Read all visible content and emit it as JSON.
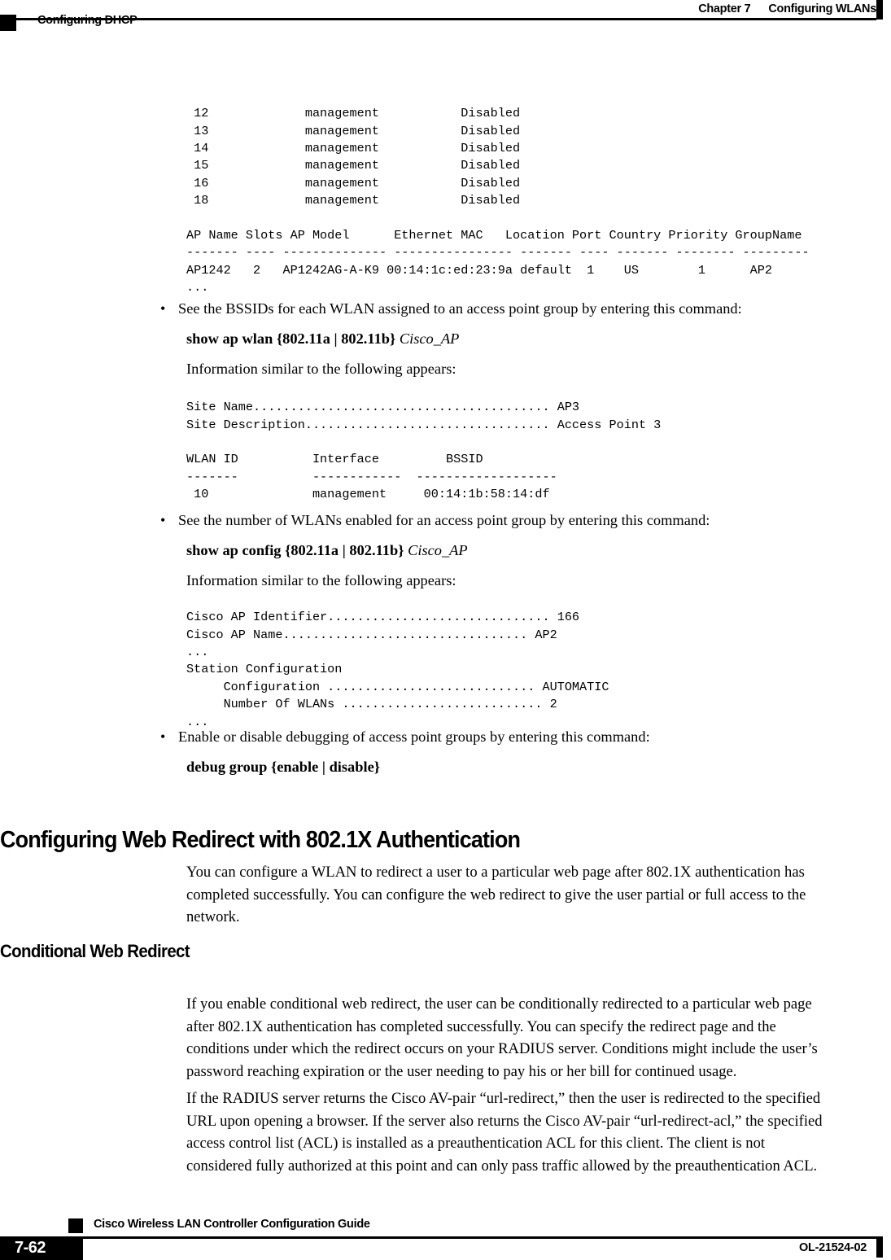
{
  "header": {
    "chapter": "Chapter 7",
    "chapter_title": "Configuring WLANs",
    "section": "Configuring DHCP"
  },
  "code_block_1": " 12             management           Disabled\n 13             management           Disabled\n 14             management           Disabled\n 15             management           Disabled\n 16             management           Disabled\n 18             management           Disabled\n\nAP Name Slots AP Model      Ethernet MAC   Location Port Country Priority GroupName\n------- ---- -------------- ---------------- ------- ---- ------- -------- ---------\nAP1242   2   AP1242AG-A-K9 00:14:1c:ed:23:9a default  1    US        1      AP2\n...",
  "bullet_1": {
    "text": "See the BSSIDs for each WLAN assigned to an access point group by entering this command:",
    "command_bold_1": "show ap wlan",
    "command_brace_open": "{",
    "command_opt_1": "802.11a",
    "command_pipe": "|",
    "command_opt_2": "802.11b",
    "command_brace_close": "}",
    "command_italic": "Cisco_AP",
    "lead": "Information similar to the following appears:"
  },
  "code_block_2": "Site Name........................................ AP3\nSite Description................................. Access Point 3\n\nWLAN ID          Interface         BSSID\n-------          ------------  -------------------\n 10              management     00:14:1b:58:14:df",
  "bullet_2": {
    "text": "See the number of WLANs enabled for an access point group by entering this command:",
    "command_bold_1": "show ap config",
    "command_brace_open": "{",
    "command_opt_1": "802.11a",
    "command_pipe": "|",
    "command_opt_2": "802.11b",
    "command_brace_close": "}",
    "command_italic": "Cisco_AP",
    "lead": "Information similar to the following appears:"
  },
  "code_block_3": "Cisco AP Identifier.............................. 166\nCisco AP Name................................. AP2\n...\nStation Configuration\n     Configuration ............................ AUTOMATIC\n     Number Of WLANs ........................... 2\n...",
  "bullet_3": {
    "text": "Enable or disable debugging of access point groups by entering this command:",
    "command_bold_1": "debug group",
    "command_brace_open": "{",
    "command_opt_1": "enable",
    "command_pipe": "|",
    "command_opt_2": "disable",
    "command_brace_close": "}"
  },
  "section_heading": "Configuring Web Redirect with 802.1X Authentication",
  "section_paragraph": [
    "You can configure a WLAN to redirect a user to a particular web page after 802.1X authentication has",
    "completed successfully. You can configure the web redirect to give the user partial or full access to the",
    "network."
  ],
  "subsection_heading": "Conditional Web Redirect",
  "subsection_paragraph_1": [
    "If you enable conditional web redirect, the user can be conditionally redirected to a particular web page",
    "after 802.1X authentication has completed successfully. You can specify the redirect page and the",
    "conditions under which the redirect occurs on your RADIUS server. Conditions might include the user’s",
    "password reaching expiration or the user needing to pay his or her bill for continued usage."
  ],
  "subsection_paragraph_2": [
    "If the RADIUS server returns the Cisco AV-pair “url-redirect,” then the user is redirected to the specified",
    "URL upon opening a browser. If the server also returns the Cisco AV-pair “url-redirect-acl,” the specified",
    "access control list (ACL) is installed as a preauthentication ACL for this client. The client is not",
    "considered fully authorized at this point and can only pass traffic allowed by the preauthentication ACL."
  ],
  "footer": {
    "guide_title": "Cisco Wireless LAN Controller Configuration Guide",
    "page_number": "7-62",
    "doc_id": "OL-21524-02"
  }
}
